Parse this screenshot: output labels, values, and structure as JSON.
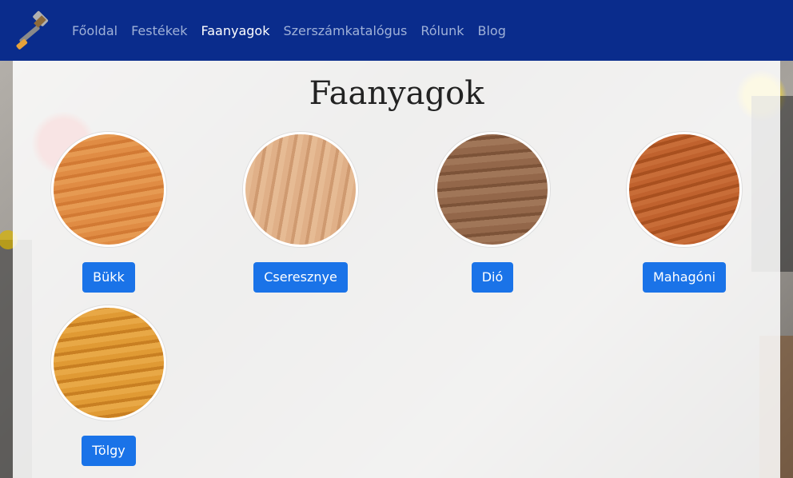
{
  "nav": {
    "logo_icon": "hammer-icon",
    "items": [
      {
        "label": "Főoldal",
        "active": false
      },
      {
        "label": "Festékek",
        "active": false
      },
      {
        "label": "Faanyagok",
        "active": true
      },
      {
        "label": "Szerszámkatalógus",
        "active": false
      },
      {
        "label": "Rólunk",
        "active": false
      },
      {
        "label": "Blog",
        "active": false
      }
    ]
  },
  "page": {
    "title": "Faanyagok"
  },
  "woods": [
    {
      "label": "Bükk",
      "color": "#d9843a"
    },
    {
      "label": "Cseresznye",
      "color": "#d9a47a"
    },
    {
      "label": "Dió",
      "color": "#8a5e3e"
    },
    {
      "label": "Mahagóni",
      "color": "#b55a2a"
    },
    {
      "label": "Tölgy",
      "color": "#d68d2a"
    }
  ],
  "colors": {
    "navbar": "#0a2c8c",
    "button": "#1a73e8"
  }
}
